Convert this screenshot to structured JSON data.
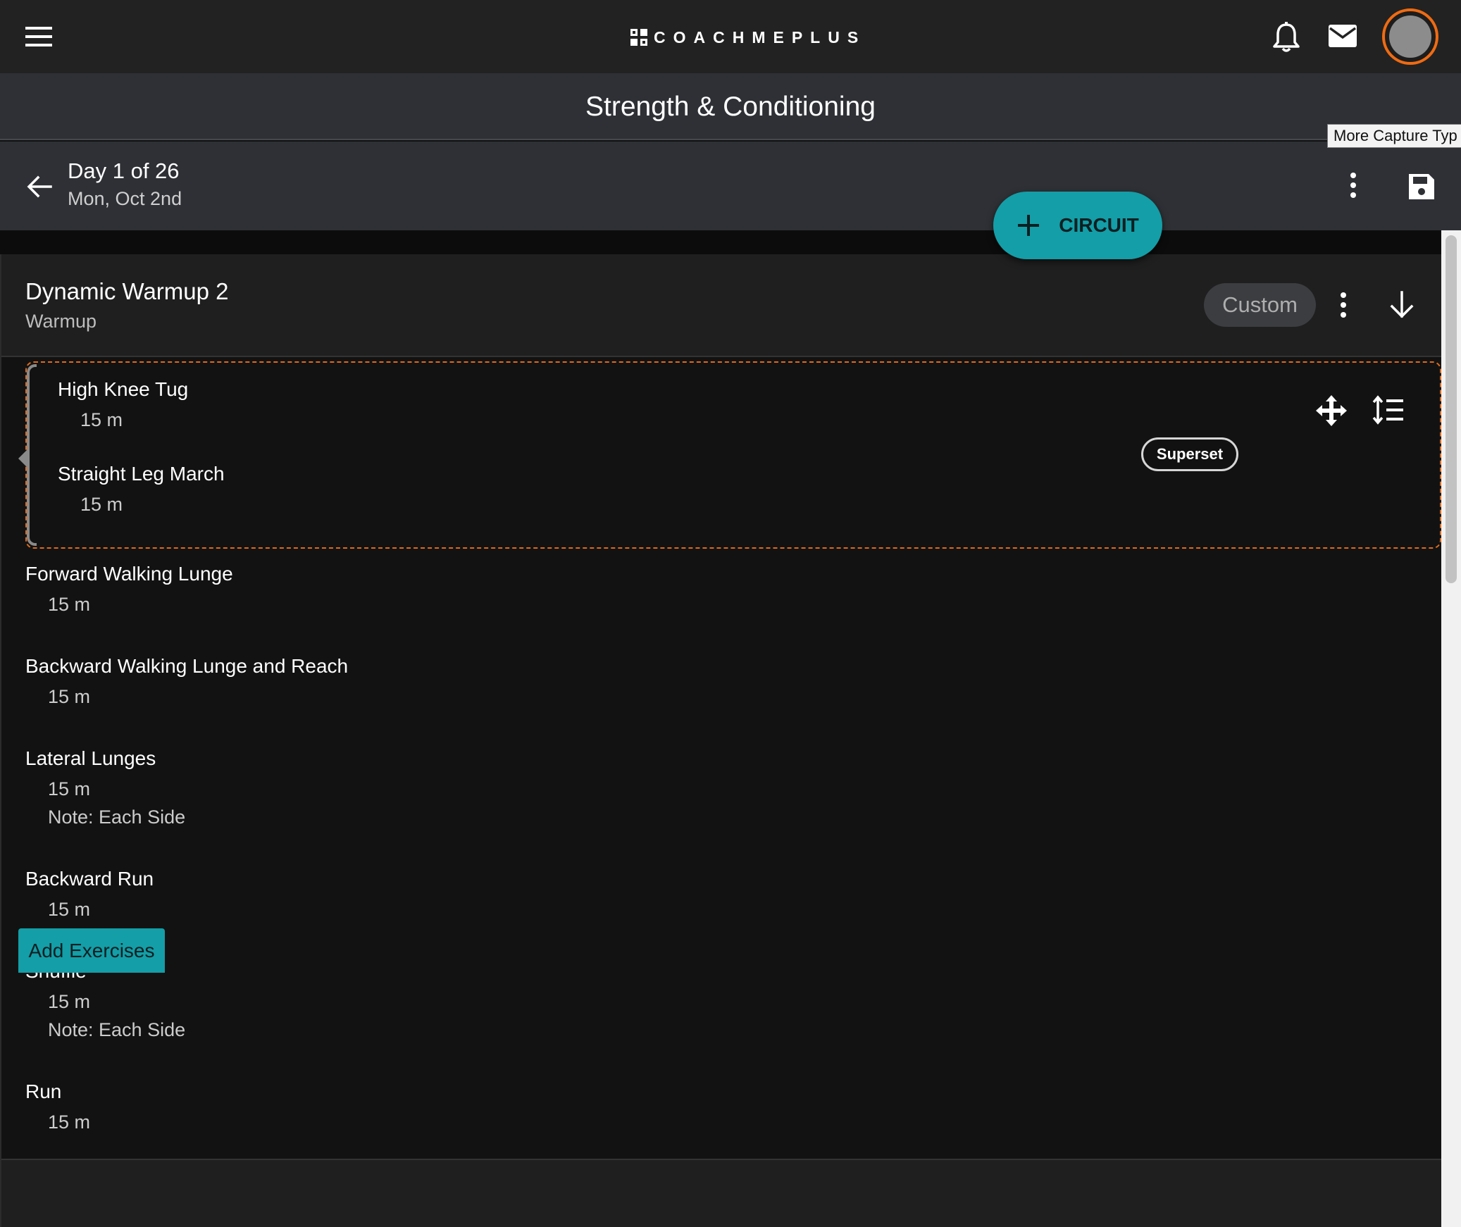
{
  "header": {
    "logo_text": "COACHMEPLUS",
    "icons": [
      "menu-icon",
      "bell-icon",
      "mail-icon",
      "avatar"
    ]
  },
  "module": {
    "title": "Strength & Conditioning"
  },
  "tooltip": {
    "text": "More Capture Typ"
  },
  "day": {
    "title": "Day 1 of 26",
    "date": "Mon, Oct 2nd"
  },
  "circuit_button": {
    "label": "CIRCUIT"
  },
  "block": {
    "title": "Dynamic Warmup 2",
    "subtitle": "Warmup",
    "chip": "Custom",
    "superset": {
      "badge": "Superset",
      "exercises": [
        {
          "name": "High Knee Tug",
          "value": "15 m"
        },
        {
          "name": "Straight Leg March",
          "value": "15 m"
        }
      ]
    },
    "exercises": [
      {
        "name": "Forward Walking Lunge",
        "value": "15 m"
      },
      {
        "name": "Backward Walking Lunge and Reach",
        "value": "15 m"
      },
      {
        "name": "Lateral Lunges",
        "value": "15 m",
        "note": "Note: Each Side"
      },
      {
        "name": "Backward Run",
        "value": "15 m"
      },
      {
        "name": "Shuffle",
        "value": "15 m",
        "note": "Note: Each Side"
      },
      {
        "name": "Run",
        "value": "15 m"
      }
    ]
  },
  "footer": {
    "add_button": "Add Exercises"
  },
  "colors": {
    "accent": "#149ea7",
    "superset_border": "#e06a1b",
    "avatar_ring": "#f06b12",
    "app_bar": "#222222",
    "sub_bar": "#2e3035",
    "background": "#111111"
  }
}
